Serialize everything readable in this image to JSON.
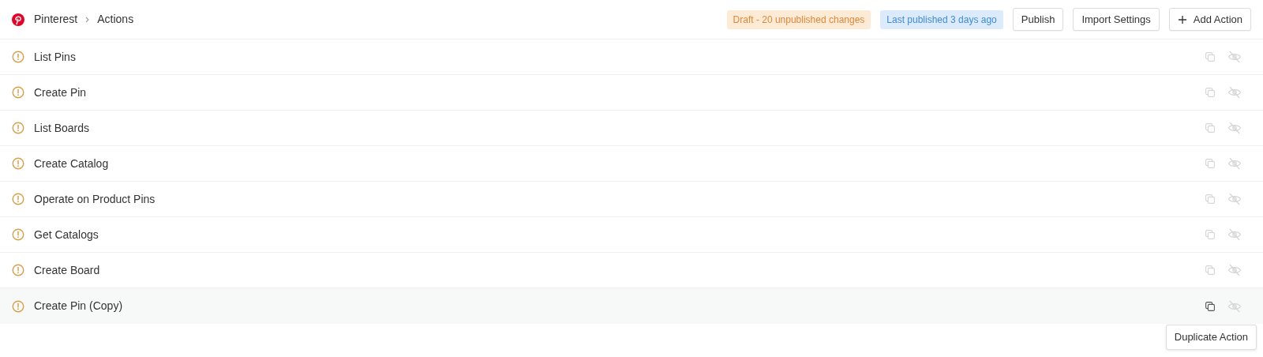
{
  "breadcrumb": [
    "Pinterest",
    "Actions"
  ],
  "badges": [
    {
      "text": "Draft - 20 unpublished changes",
      "kind": "draft"
    },
    {
      "text": "Last published 3 days ago",
      "kind": "published"
    }
  ],
  "buttons": [
    {
      "label": "Publish",
      "kind": "plain"
    },
    {
      "label": "Import Settings",
      "kind": "plain"
    },
    {
      "label": "Add Action",
      "kind": "add"
    }
  ],
  "actions": [
    {
      "name": "List Pins",
      "hovered": false
    },
    {
      "name": "Create Pin",
      "hovered": false
    },
    {
      "name": "List Boards",
      "hovered": false
    },
    {
      "name": "Create Catalog",
      "hovered": false
    },
    {
      "name": "Operate on Product Pins",
      "hovered": false
    },
    {
      "name": "Get Catalogs",
      "hovered": false
    },
    {
      "name": "Create Board",
      "hovered": false
    },
    {
      "name": "Create Pin (Copy)",
      "hovered": true
    }
  ],
  "tooltip": "Duplicate Action"
}
